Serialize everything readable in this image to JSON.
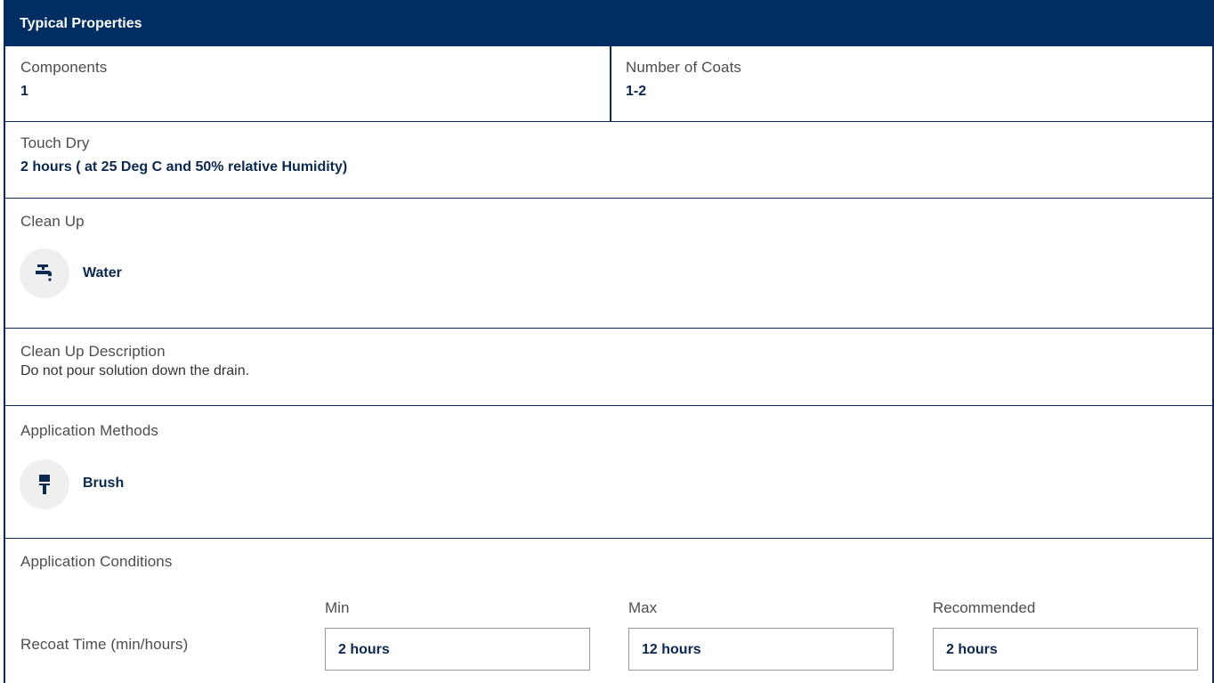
{
  "header": {
    "title": "Typical Properties"
  },
  "components": {
    "label": "Components",
    "value": "1"
  },
  "coats": {
    "label": "Number of Coats",
    "value": "1-2"
  },
  "touch_dry": {
    "label": "Touch Dry",
    "value": "2 hours ( at 25 Deg C and 50% relative Humidity)"
  },
  "clean_up": {
    "label": "Clean Up",
    "item": {
      "icon": "water-tap-icon",
      "label": "Water"
    }
  },
  "clean_up_description": {
    "label": "Clean Up Description",
    "text": "Do not pour solution down the drain."
  },
  "application_methods": {
    "label": "Application Methods",
    "item": {
      "icon": "paint-brush-icon",
      "label": "Brush"
    }
  },
  "application_conditions": {
    "label": "Application Conditions",
    "columns": {
      "min": "Min",
      "max": "Max",
      "recommended": "Recommended"
    },
    "recoat": {
      "label": "Recoat Time (min/hours)",
      "min": "2 hours",
      "max": "12 hours",
      "recommended": "2 hours"
    }
  },
  "colors": {
    "header_bg": "#002d62",
    "value_text": "#0a2850",
    "border": "#0c2a5c",
    "icon_bg": "#efefef"
  }
}
